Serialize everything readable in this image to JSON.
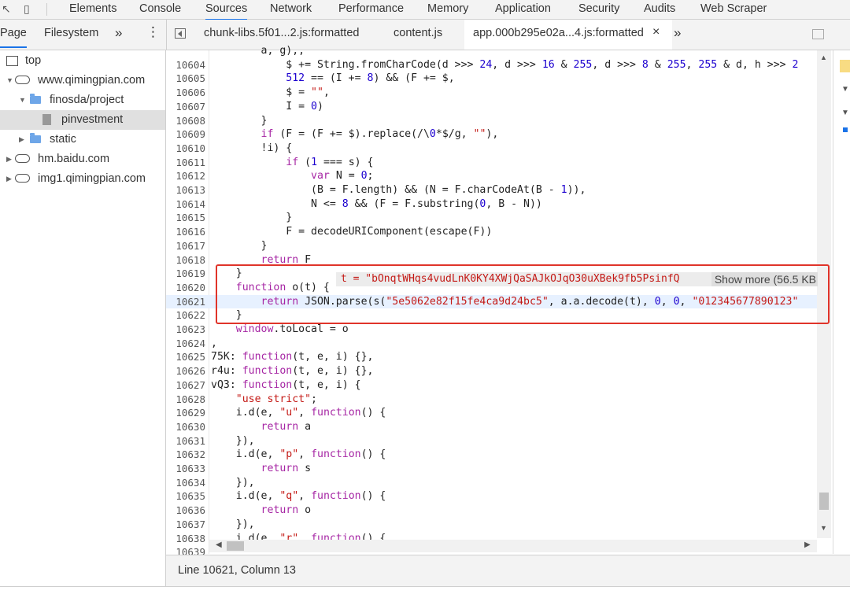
{
  "devtools": {
    "main_tabs": [
      "Elements",
      "Console",
      "Sources",
      "Network",
      "Performance",
      "Memory",
      "Application",
      "Security",
      "Audits",
      "Web Scraper"
    ],
    "active_tab": "Sources"
  },
  "navigator": {
    "tabs": [
      "Page",
      "Filesystem"
    ],
    "more_symbol": "»",
    "menu_symbol": "⋮",
    "tree": [
      {
        "label": "top",
        "indent": 0,
        "type": "frame",
        "expanded": true
      },
      {
        "label": "www.qimingpian.com",
        "indent": 1,
        "type": "cloud",
        "expanded": true
      },
      {
        "label": "finosda/project",
        "indent": 2,
        "type": "folder",
        "expanded": true
      },
      {
        "label": "pinvestment",
        "indent": 3,
        "type": "file",
        "selected": true
      },
      {
        "label": "static",
        "indent": 2,
        "type": "folder",
        "expanded": false
      },
      {
        "label": "hm.baidu.com",
        "indent": 1,
        "type": "cloud",
        "expanded": false
      },
      {
        "label": "img1.qimingpian.com",
        "indent": 1,
        "type": "cloud",
        "expanded": false
      }
    ]
  },
  "editor_tabs": [
    {
      "label": "chunk-libs.5f01...2.js:formatted",
      "active": false
    },
    {
      "label": "content.js",
      "active": false
    },
    {
      "label": "app.000b295e02a...4.js:formatted",
      "active": true
    }
  ],
  "close_symbol": "×",
  "more_tabs_symbol": "»",
  "code_lines": [
    {
      "n": "",
      "t": "        a, g),,"
    },
    {
      "n": "10604",
      "t": "            $ += String.fromCharCode(d >>> 24, d >>> 16 & 255, d >>> 8 & 255, 255 & d, h >>> 2"
    },
    {
      "n": "10605",
      "t": "            512 == (I += 8) && (F += $,"
    },
    {
      "n": "10606",
      "t": "            $ = \"\","
    },
    {
      "n": "10607",
      "t": "            I = 0)"
    },
    {
      "n": "10608",
      "t": "        }"
    },
    {
      "n": "10609",
      "t": "        if (F = (F += $).replace(/\\0*$/g, \"\"),"
    },
    {
      "n": "10610",
      "t": "        !i) {"
    },
    {
      "n": "10611",
      "t": "            if (1 === s) {"
    },
    {
      "n": "10612",
      "t": "                var N = 0;"
    },
    {
      "n": "10613",
      "t": "                (B = F.length) && (N = F.charCodeAt(B - 1)),"
    },
    {
      "n": "10614",
      "t": "                N <= 8 && (F = F.substring(0, B - N))"
    },
    {
      "n": "10615",
      "t": "            }"
    },
    {
      "n": "10616",
      "t": "            F = decodeURIComponent(escape(F))"
    },
    {
      "n": "10617",
      "t": "        }"
    },
    {
      "n": "10618",
      "t": "        return F"
    },
    {
      "n": "10619",
      "t": "    }"
    },
    {
      "n": "10620",
      "t": "    function o(t) {"
    },
    {
      "n": "10621",
      "t": "        return JSON.parse(s(\"5e5062e82f15fe4ca9d24bc5\", a.a.decode(t), 0, 0, \"012345677890123\""
    },
    {
      "n": "10622",
      "t": "    }"
    },
    {
      "n": "10623",
      "t": "    window.toLocal = o"
    },
    {
      "n": "10624",
      "t": ","
    },
    {
      "n": "10625",
      "t": "75K: function(t, e, i) {},"
    },
    {
      "n": "10626",
      "t": "r4u: function(t, e, i) {},"
    },
    {
      "n": "10627",
      "t": "vQ3: function(t, e, i) {"
    },
    {
      "n": "10628",
      "t": "    \"use strict\";"
    },
    {
      "n": "10629",
      "t": "    i.d(e, \"u\", function() {"
    },
    {
      "n": "10630",
      "t": "        return a"
    },
    {
      "n": "10631",
      "t": "    }),"
    },
    {
      "n": "10632",
      "t": "    i.d(e, \"p\", function() {"
    },
    {
      "n": "10633",
      "t": "        return s"
    },
    {
      "n": "10634",
      "t": "    }),"
    },
    {
      "n": "10635",
      "t": "    i.d(e, \"q\", function() {"
    },
    {
      "n": "10636",
      "t": "        return o"
    },
    {
      "n": "10637",
      "t": "    }),"
    },
    {
      "n": "10638",
      "t": "    i.d(e, \"r\", function() {"
    },
    {
      "n": "10639",
      "t": ""
    }
  ],
  "inline_value": {
    "text": "t = \"bOnqtWHqs4vudLnK0KY4XWjQaSAJkOJqO30uXBek9fb5PsinfQ",
    "show_more": "Show more (56.5 KB"
  },
  "status": "Line 10621, Column 13",
  "colors": {
    "accent": "#1a73e8",
    "highlight_box": "#e0342a",
    "selection": "#e0e0e0"
  }
}
